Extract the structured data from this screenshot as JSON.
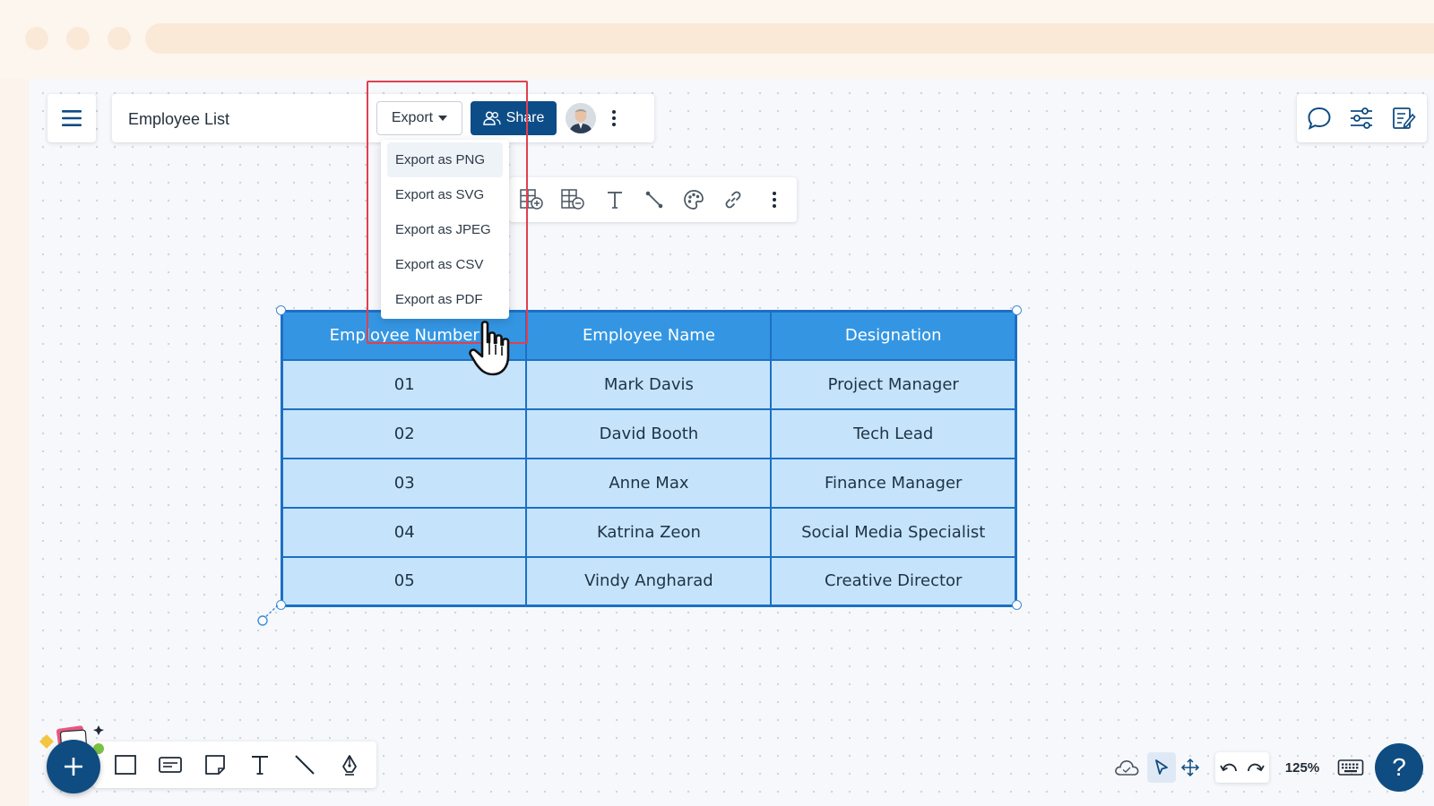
{
  "document": {
    "title": "Employee List"
  },
  "header": {
    "export_label": "Export",
    "share_label": "Share"
  },
  "export_menu": {
    "items": [
      "Export as PNG",
      "Export as SVG",
      "Export as JPEG",
      "Export as CSV",
      "Export as PDF"
    ],
    "active_index": 0
  },
  "table": {
    "headers": [
      "Employee Number",
      "Employee Name",
      "Designation"
    ],
    "rows": [
      [
        "01",
        "Mark Davis",
        "Project Manager"
      ],
      [
        "02",
        "David Booth",
        "Tech Lead"
      ],
      [
        "03",
        "Anne Max",
        "Finance Manager"
      ],
      [
        "04",
        "Katrina Zeon",
        "Social Media Specialist"
      ],
      [
        "05",
        "Vindy Angharad",
        "Creative Director"
      ]
    ]
  },
  "footer": {
    "zoom": "125%",
    "help": "?"
  },
  "icons": {
    "menu": "hamburger-icon",
    "comments": "comment-icon",
    "settings": "sliders-icon",
    "notes": "edit-notes-icon",
    "cursor": "hand-cursor-icon"
  },
  "colors": {
    "primary": "#0d4d87",
    "table_header": "#3496e3",
    "table_cell": "#c5e4fb",
    "table_border": "#1d6fc4",
    "highlight": "#e0404f"
  }
}
